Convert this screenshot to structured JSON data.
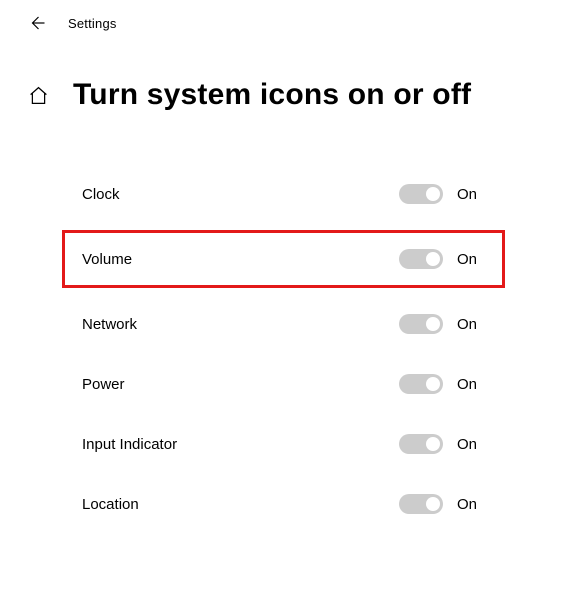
{
  "header": {
    "title": "Settings"
  },
  "page": {
    "title": "Turn system icons on or off"
  },
  "toggles": {
    "on_label": "On"
  },
  "list": {
    "items": [
      {
        "label": "Clock",
        "state_label": "On",
        "on": true,
        "highlighted": false
      },
      {
        "label": "Volume",
        "state_label": "On",
        "on": true,
        "highlighted": true
      },
      {
        "label": "Network",
        "state_label": "On",
        "on": true,
        "highlighted": false
      },
      {
        "label": "Power",
        "state_label": "On",
        "on": true,
        "highlighted": false
      },
      {
        "label": "Input Indicator",
        "state_label": "On",
        "on": true,
        "highlighted": false
      },
      {
        "label": "Location",
        "state_label": "On",
        "on": true,
        "highlighted": false
      }
    ]
  },
  "highlight": {
    "color": "#e31919"
  }
}
